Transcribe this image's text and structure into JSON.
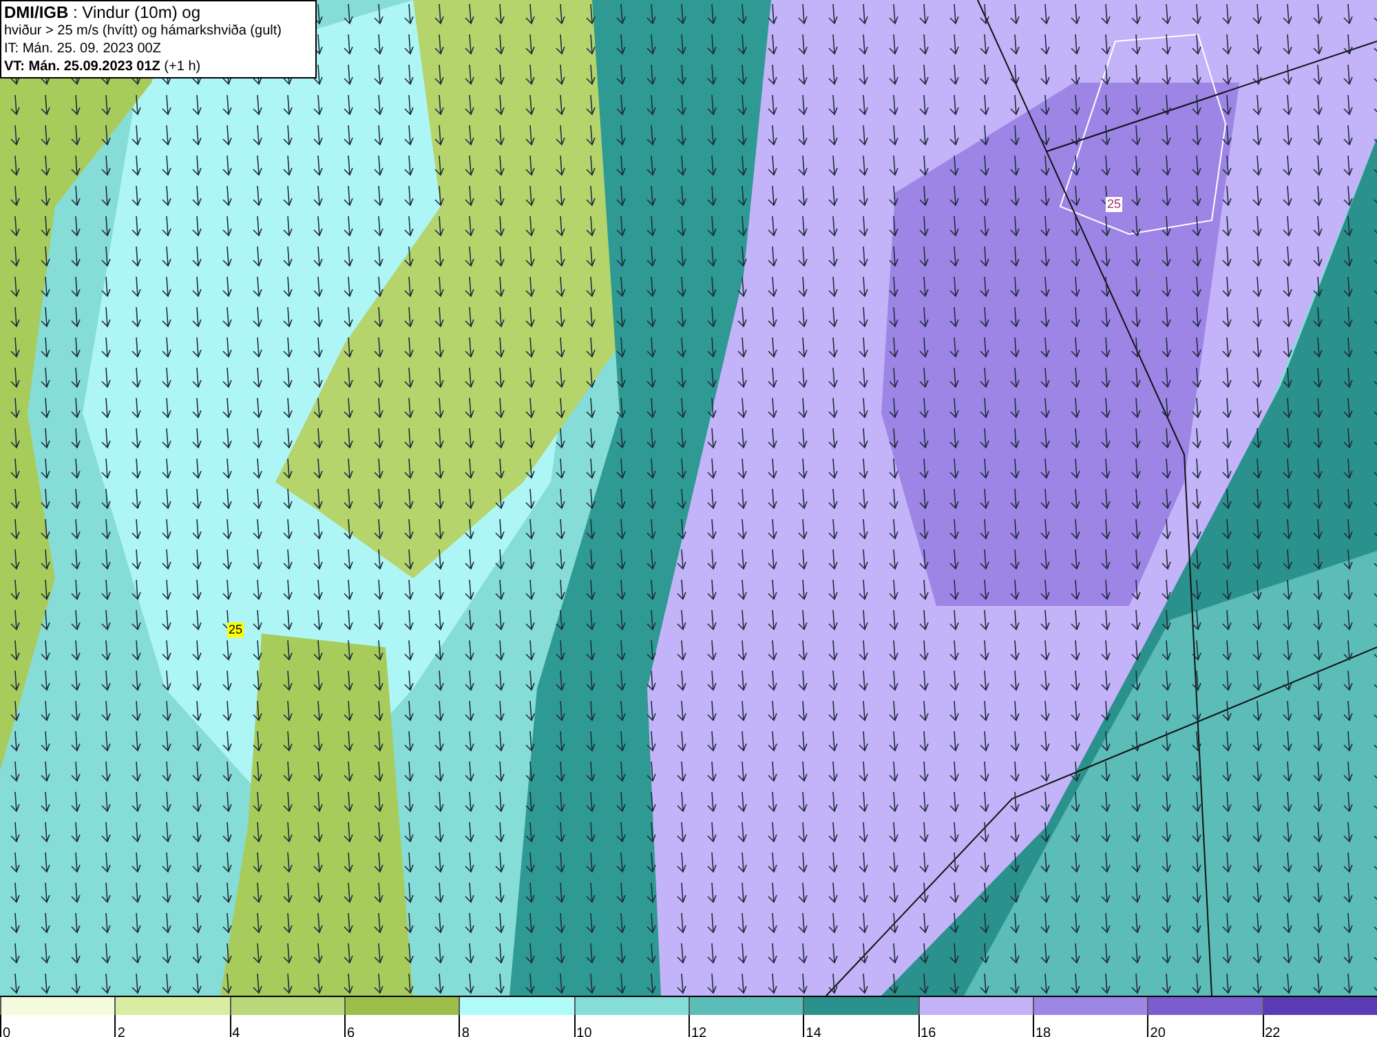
{
  "header": {
    "lines": [
      "**DMI/IGB** : Vindur (10m) og",
      "hviður > 25 m/s (hvítt) og hámarkshviða (gult)",
      "IT: Mán. 25. 09. 2023 00Z",
      "**VT: Mán. 25.09.2023 01Z** (+1 h)"
    ]
  },
  "contour_labels": [
    {
      "text": "25",
      "kind": "gust"
    },
    {
      "text": "25",
      "kind": "max_gust"
    }
  ],
  "legend": [
    {
      "label": "0",
      "color": "#f4fbdc"
    },
    {
      "label": "2",
      "color": "#d9eda2"
    },
    {
      "label": "4",
      "color": "#bbd87a"
    },
    {
      "label": "6",
      "color": "#9dbf4a"
    },
    {
      "label": "8",
      "color": "#aefbf8"
    },
    {
      "label": "10",
      "color": "#86ddd8"
    },
    {
      "label": "12",
      "color": "#5cbcb8"
    },
    {
      "label": "14",
      "color": "#2a918c"
    },
    {
      "label": "16",
      "color": "#c4b3f8"
    },
    {
      "label": "18",
      "color": "#9e86e4"
    },
    {
      "label": "20",
      "color": "#7b5dcf"
    },
    {
      "label": "22",
      "color": "#5a3bb3"
    }
  ]
}
